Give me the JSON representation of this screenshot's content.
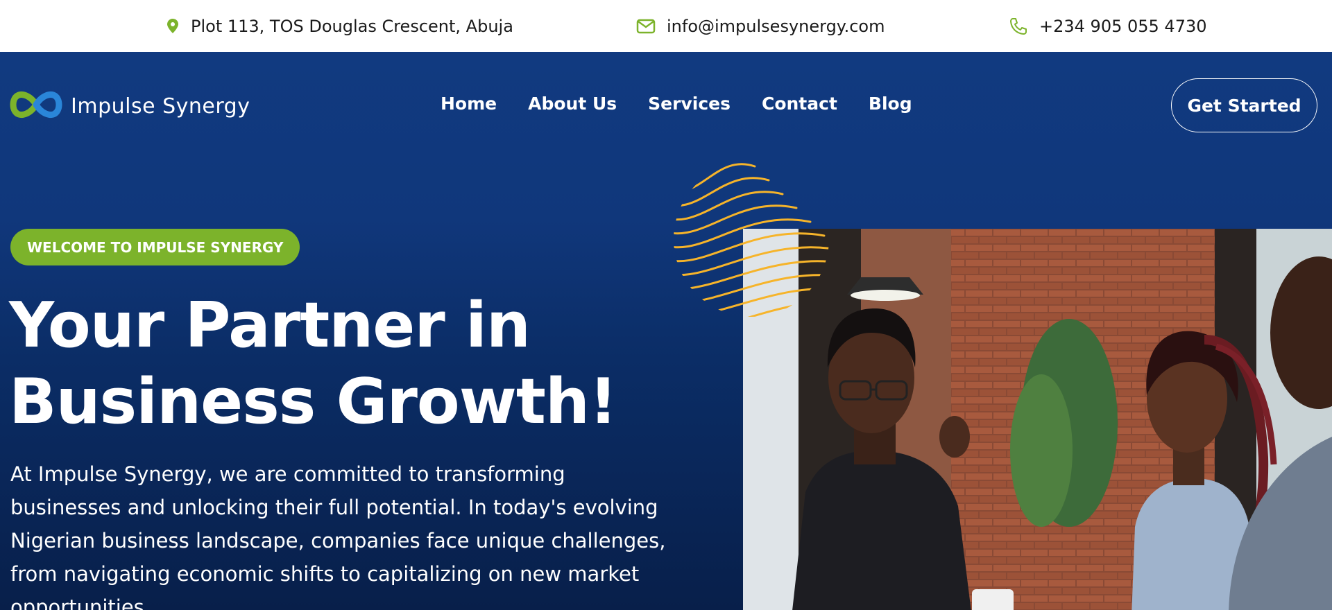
{
  "topbar": {
    "address": "Plot 113, TOS Douglas Crescent, Abuja",
    "email": "info@impulsesynergy.com",
    "phone": "+234 905 055 4730",
    "icon_color": "#7cb32b"
  },
  "header": {
    "brand": "Impulse Synergy",
    "nav": [
      "Home",
      "About Us",
      "Services",
      "Contact",
      "Blog"
    ],
    "cta": "Get Started"
  },
  "hero": {
    "badge": "WELCOME TO IMPULSE SYNERGY",
    "title_line1": "Your Partner in",
    "title_line2": "Business Growth!",
    "description": "At Impulse Synergy, we are committed to transforming businesses and unlocking their full potential. In today's evolving Nigerian business landscape, companies face unique challenges, from navigating economic shifts to capitalizing on new market opportunities."
  },
  "colors": {
    "primary_blue": "#10377b",
    "accent_green": "#7cb32b",
    "accent_yellow": "#f6b42a"
  }
}
